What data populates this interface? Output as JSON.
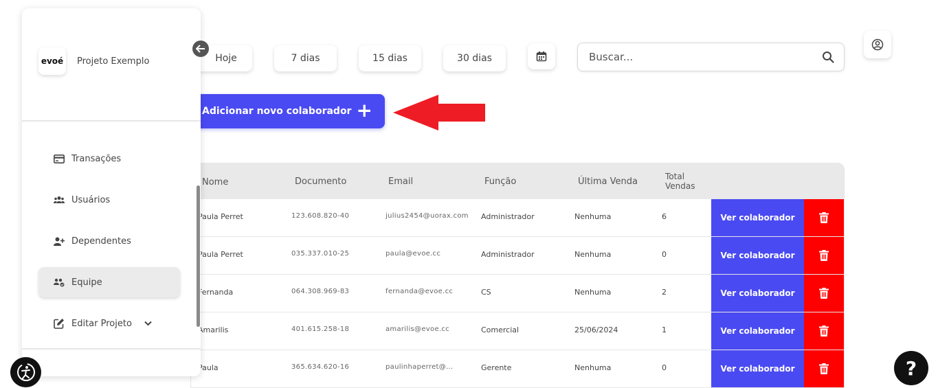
{
  "filters": {
    "today": "Hoje",
    "d7": "7 dias",
    "d15": "15 dias",
    "d30": "30 dias"
  },
  "search": {
    "placeholder": "Buscar..."
  },
  "add_button": {
    "label": "Adicionar novo colaborador",
    "plus": "+"
  },
  "table": {
    "headers": {
      "nome": "Nome",
      "documento": "Documento",
      "email": "Email",
      "funcao": "Função",
      "ultima_venda": "Última Venda",
      "total_1": "Total",
      "total_2": "Vendas"
    },
    "rows": [
      {
        "nome": "Paula Perret",
        "documento": "123.608.820-40",
        "email": "julius2454@uorax.com",
        "funcao": "Administrador",
        "ultima_venda": "Nenhuma",
        "total": "6",
        "action": "Ver colaborador"
      },
      {
        "nome": "Paula Perret",
        "documento": "035.337.010-25",
        "email": "paula@evoe.cc",
        "funcao": "Administrador",
        "ultima_venda": "Nenhuma",
        "total": "0",
        "action": "Ver colaborador"
      },
      {
        "nome": "Fernanda",
        "documento": "064.308.969-83",
        "email": "fernanda@evoe.cc",
        "funcao": "CS",
        "ultima_venda": "Nenhuma",
        "total": "2",
        "action": "Ver colaborador"
      },
      {
        "nome": "Amarilis",
        "documento": "401.615.258-18",
        "email": "amarilis@evoe.cc",
        "funcao": "Comercial",
        "ultima_venda": "25/06/2024",
        "total": "1",
        "action": "Ver colaborador"
      },
      {
        "nome": "Paula",
        "documento": "365.634.620-16",
        "email": "paulinhaperret@...",
        "funcao": "Gerente",
        "ultima_venda": "Nenhuma",
        "total": "0",
        "action": "Ver colaborador"
      }
    ]
  },
  "sidebar": {
    "logo": "evoé",
    "project_name": "Projeto Exemplo",
    "items": [
      {
        "label": "Transações"
      },
      {
        "label": "Usuários"
      },
      {
        "label": "Dependentes"
      },
      {
        "label": "Equipe"
      },
      {
        "label": "Editar Projeto"
      }
    ]
  },
  "help": {
    "label": "?"
  },
  "colors": {
    "accent": "#4a4af2",
    "danger": "#ff0000",
    "arrow": "#ee1c24"
  }
}
